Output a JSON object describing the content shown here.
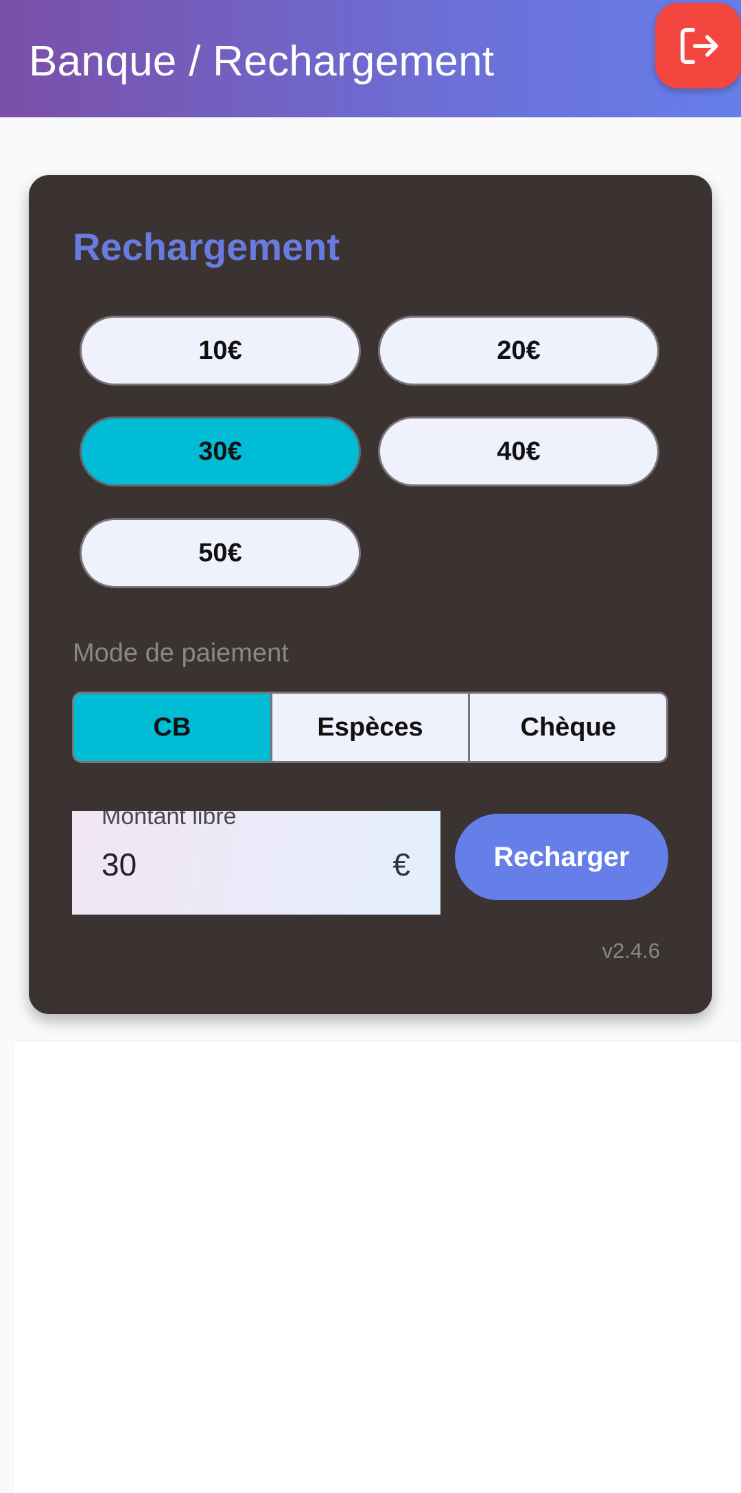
{
  "app_bar": {
    "title": "Banque / Rechargement",
    "logout_icon": "logout-icon",
    "accent_color": "#f2463e"
  },
  "card": {
    "title": "Rechargement",
    "amount_options": [
      {
        "label": "10€",
        "selected": false
      },
      {
        "label": "20€",
        "selected": false
      },
      {
        "label": "30€",
        "selected": true
      },
      {
        "label": "40€",
        "selected": false
      },
      {
        "label": "50€",
        "selected": false
      }
    ],
    "payment_label": "Mode de paiement",
    "payment_methods": [
      {
        "label": "CB",
        "selected": true
      },
      {
        "label": "Espèces",
        "selected": false
      },
      {
        "label": "Chèque",
        "selected": false
      }
    ],
    "free_amount": {
      "label": "Montant libre",
      "value": "30",
      "suffix": "€"
    },
    "recharge_label": "Recharger",
    "version": "v2.4.6"
  },
  "colors": {
    "selected": "#00bcd4",
    "primary": "#667ee8",
    "title": "#6a7be0",
    "card_background": "#3a3332"
  }
}
